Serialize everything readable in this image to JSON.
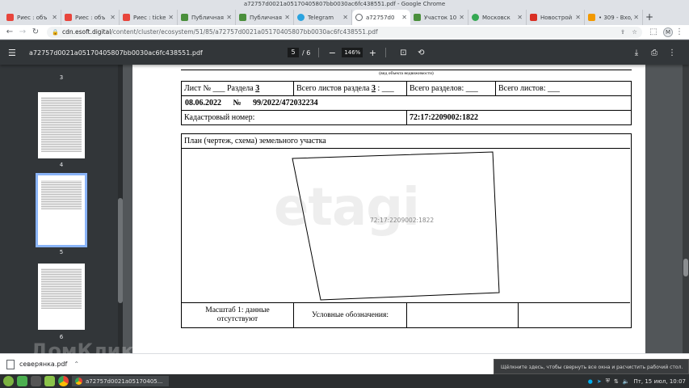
{
  "window_title": "a72757d0021a05170405807bb0030ac6fc438551.pdf - Google Chrome",
  "tabs": [
    {
      "label": "Риес : объ",
      "color": "#e8453c",
      "active": false
    },
    {
      "label": "Риес : объ",
      "color": "#e8453c",
      "active": false
    },
    {
      "label": "Риес : ticke",
      "color": "#e8453c",
      "active": false
    },
    {
      "label": "Публичная",
      "color": "#4a8f3c",
      "active": false
    },
    {
      "label": "Публичная",
      "color": "#4a8f3c",
      "active": false
    },
    {
      "label": "Telegram",
      "color": "#2aa3df",
      "active": false
    },
    {
      "label": "a72757d0",
      "color": "#5f6368",
      "active": true
    },
    {
      "label": "Участок 10",
      "color": "#4a8f3c",
      "active": false
    },
    {
      "label": "Московск",
      "color": "#34a853",
      "active": false
    },
    {
      "label": "Новострой",
      "color": "#d93025",
      "active": false
    },
    {
      "label": "• 309 - Вход",
      "color": "#f29900",
      "active": false
    }
  ],
  "address": {
    "host": "cdn.esoft.digital",
    "path": "/content/cluster/ecosystem/51/85/a72757d0021a05170405807bb0030ac6fc438551.pdf",
    "avatar": "M"
  },
  "pdf_toolbar": {
    "filename": "a72757d0021a05170405807bb0030ac6fc438551.pdf",
    "current_page": "5",
    "total_pages": "/ 6",
    "zoom": "146%"
  },
  "thumbnails": [
    "3",
    "4",
    "5",
    "6"
  ],
  "document": {
    "caption": "(вид объекта недвижимости)",
    "row1": {
      "sheet": "Лист № ___ Раздела ",
      "section_num": "3",
      "total_sheets_label": "Всего листов раздела ",
      "total_sheets_num": "3",
      "total_sheets_tail": " : ___",
      "total_sections": "Всего разделов: ___",
      "total_pages": "Всего листов: ___"
    },
    "row2": {
      "date": "08.06.2022",
      "num_label": "№",
      "reg_number": "99/2022/472032234"
    },
    "row3": {
      "cad_label": "Кадастровый номер:",
      "cad_number": "72:17:2209002:1822"
    },
    "plan_title": "План (чертеж, схема) земельного участка",
    "parcel_label": "72:17:2209002:1822",
    "scale_line1": "Масштаб 1: данные",
    "scale_line2": "отсутствуют",
    "legend_label": "Условные обозначения:",
    "watermark": "etagi"
  },
  "download": {
    "filename": "северянка.pdf"
  },
  "overlay_watermark": "ДомКлик",
  "toast": "Щёлкните здесь, чтобы свернуть все окна и расчистить рабочий стол.",
  "taskbar": {
    "window_label": "a72757d0021a05170405...",
    "clock": "Пт, 15 июл, 10:07"
  }
}
